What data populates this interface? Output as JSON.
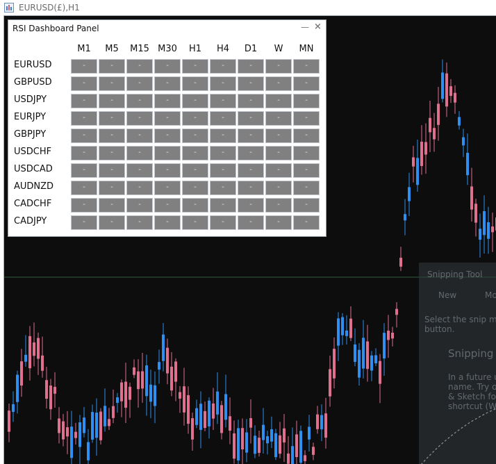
{
  "window": {
    "title": "EURUSD(£),H1",
    "icon": "chart-window-icon"
  },
  "panel": {
    "title": "RSI Dashboard Panel",
    "minimize_label": "—",
    "close_label": "×",
    "timeframes": [
      "M1",
      "M5",
      "M15",
      "M30",
      "H1",
      "H4",
      "D1",
      "W",
      "MN"
    ],
    "pairs": [
      "EURUSD",
      "GBPUSD",
      "USDJPY",
      "EURJPY",
      "GBPJPY",
      "USDCHF",
      "USDCAD",
      "AUDNZD",
      "CADCHF",
      "CADJPY"
    ],
    "cell_placeholder": "-"
  },
  "chart": {
    "background": "#0d0d0d",
    "bull_color": "#2f8ff0",
    "bear_color": "#e0708f",
    "level_line_color": "#2e5a3e"
  },
  "snipping_overlay": {
    "title": "Snipping Tool",
    "new_label": "New",
    "mode_label": "Mo",
    "hint_line1": "Select the snip mode",
    "hint_line2": "button.",
    "heading": "Snipping",
    "body_line1": "In a future up",
    "body_line2": "name. Try ou",
    "body_line3": "& Sketch for",
    "body_line4": "shortcut (Win"
  }
}
